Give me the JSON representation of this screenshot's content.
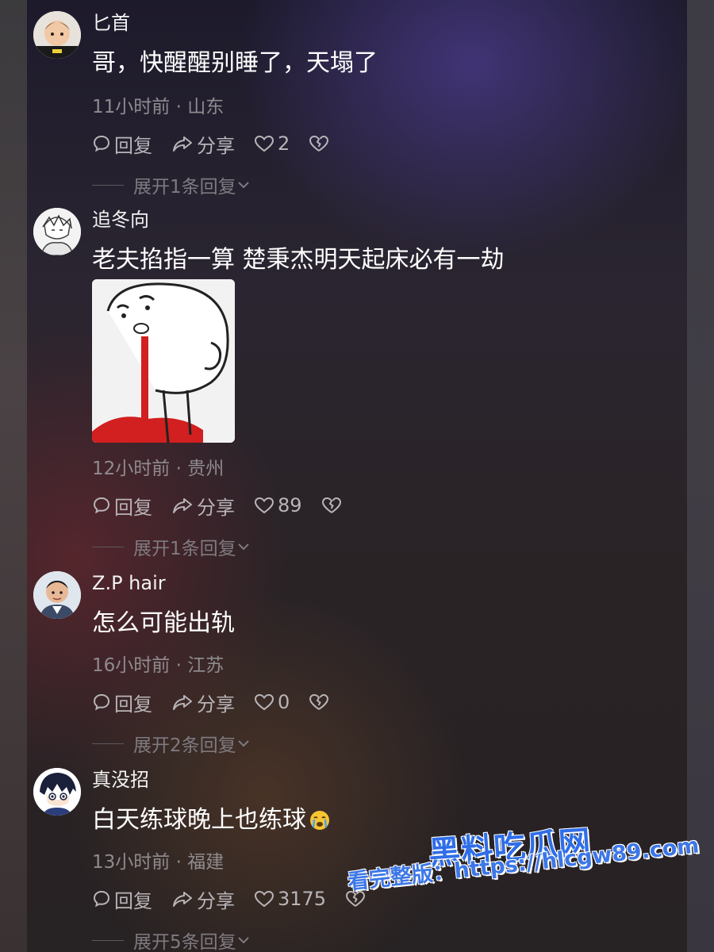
{
  "comments": [
    {
      "username": "匕首",
      "text": "哥，快醒醒别睡了，天塌了",
      "meta": "11小时前 · 山东",
      "reply_label": "回复",
      "share_label": "分享",
      "likes": "2",
      "expand_label": "展开1条回复"
    },
    {
      "username": "追冬向",
      "text": "老夫掐指一算 楚秉杰明天起床必有一劫",
      "meta": "12小时前 · 贵州",
      "reply_label": "回复",
      "share_label": "分享",
      "likes": "89",
      "expand_label": "展开1条回复"
    },
    {
      "username": "Z.P hair",
      "text": "怎么可能出轨",
      "meta": "16小时前 · 江苏",
      "reply_label": "回复",
      "share_label": "分享",
      "likes": "0",
      "expand_label": "展开2条回复"
    },
    {
      "username": "真没招",
      "text": "白天练球晚上也练球",
      "meta": "13小时前 · 福建",
      "reply_label": "回复",
      "share_label": "分享",
      "likes": "3175",
      "expand_label": "展开5条回复"
    }
  ],
  "watermark": {
    "title": "黑料吃瓜网",
    "url": "看完整版：https://hlcgw89.com"
  },
  "icons": {
    "reply": "speech-bubble-icon",
    "share": "share-arrow-icon",
    "like": "heart-outline-icon",
    "dislike": "broken-heart-icon",
    "expand": "chevron-down-icon",
    "emoji": "crying-face-emoji-icon"
  },
  "colors": {
    "watermark_blue": "#2f6ee8",
    "meta_gray": "#8f8b8f",
    "sticker_blood": "#d21f1f"
  }
}
